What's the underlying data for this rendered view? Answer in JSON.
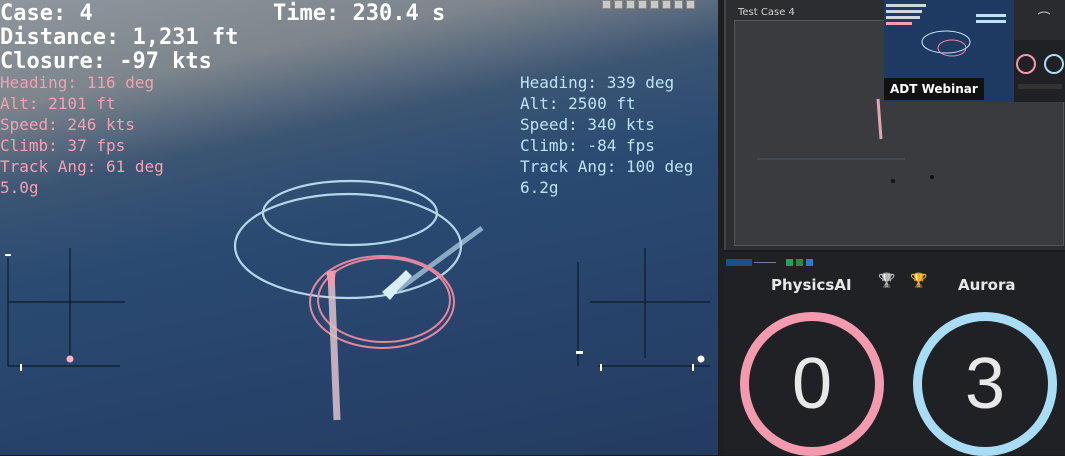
{
  "hud": {
    "case": "Case: 4",
    "time": "Time: 230.4 s",
    "distance": "Distance: 1,231 ft",
    "closure": "Closure: -97 kts"
  },
  "red_aircraft": {
    "heading": "Heading: 116 deg",
    "alt": "Alt: 2101 ft",
    "speed": "Speed: 246 kts",
    "climb": "Climb: 37 fps",
    "track": "Track Ang: 61 deg",
    "g": "5.0g"
  },
  "blue_aircraft": {
    "heading": "Heading: 339 deg",
    "alt": "Alt: 2500 ft",
    "speed": "Speed: 340 kts",
    "climb": "Climb: -84 fps",
    "track": "Track Ang: 100 deg",
    "g": "6.2g"
  },
  "preview": {
    "title": "Test Case 4",
    "webinar_label": "ADT Webinar"
  },
  "scoreboard": {
    "team_red": {
      "name": "PhysicsAI",
      "score": "0",
      "color": "#f39aaf"
    },
    "team_blue": {
      "name": "Aurora",
      "score": "3",
      "color": "#a9dcf5"
    },
    "trophy_icon": "🏆",
    "silver_trophy_icon": "🏆"
  },
  "colors": {
    "red_trail": "#f08aa2",
    "blue_trail": "#c4e6f8",
    "panel_bg": "#202124"
  }
}
